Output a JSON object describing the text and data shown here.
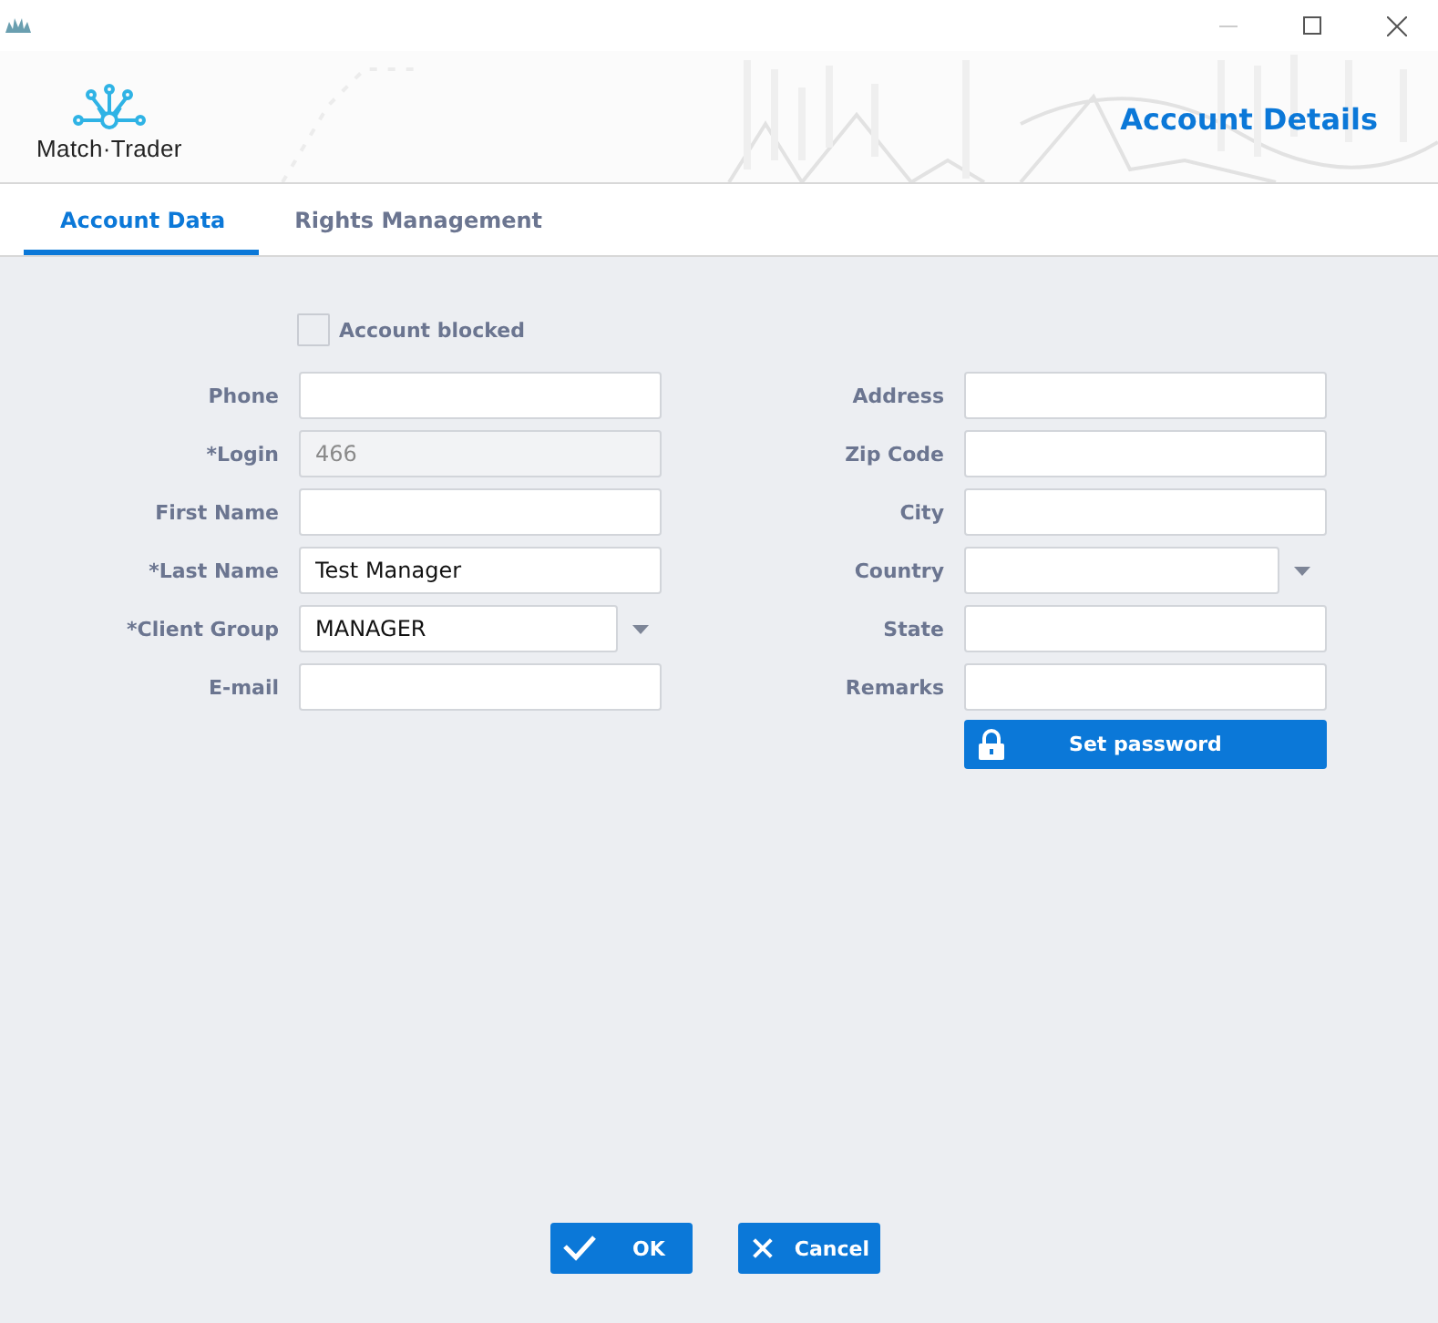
{
  "header": {
    "logo_text": "Match·Trader",
    "title": "Account Details"
  },
  "tabs": [
    {
      "label": "Account Data",
      "selected": true
    },
    {
      "label": "Rights Management",
      "selected": false
    }
  ],
  "account_blocked": {
    "label": "Account blocked",
    "checked": false
  },
  "left_fields": [
    {
      "label": "Phone",
      "kind": "text",
      "disabled": false
    },
    {
      "label": "*Login",
      "kind": "text",
      "value": "466",
      "disabled": true
    },
    {
      "label": "First Name",
      "kind": "text",
      "disabled": false
    },
    {
      "label": "*Last Name",
      "kind": "text",
      "value": "Test Manager",
      "disabled": false
    },
    {
      "label": "*Client Group",
      "kind": "select",
      "value": "MANAGER",
      "disabled": false
    },
    {
      "label": "E-mail",
      "kind": "text",
      "disabled": false
    }
  ],
  "right_fields": [
    {
      "label": "Address",
      "kind": "text",
      "disabled": false
    },
    {
      "label": "Zip Code",
      "kind": "text",
      "disabled": false
    },
    {
      "label": "City",
      "kind": "text",
      "disabled": false
    },
    {
      "label": "Country",
      "kind": "select",
      "disabled": false
    },
    {
      "label": "State",
      "kind": "text",
      "disabled": false
    },
    {
      "label": "Remarks",
      "kind": "text",
      "disabled": false
    }
  ],
  "set_password_button": "Set password",
  "buttons": [
    {
      "label": "OK",
      "kind": "ok"
    },
    {
      "label": "Cancel",
      "kind": "cancel"
    }
  ]
}
